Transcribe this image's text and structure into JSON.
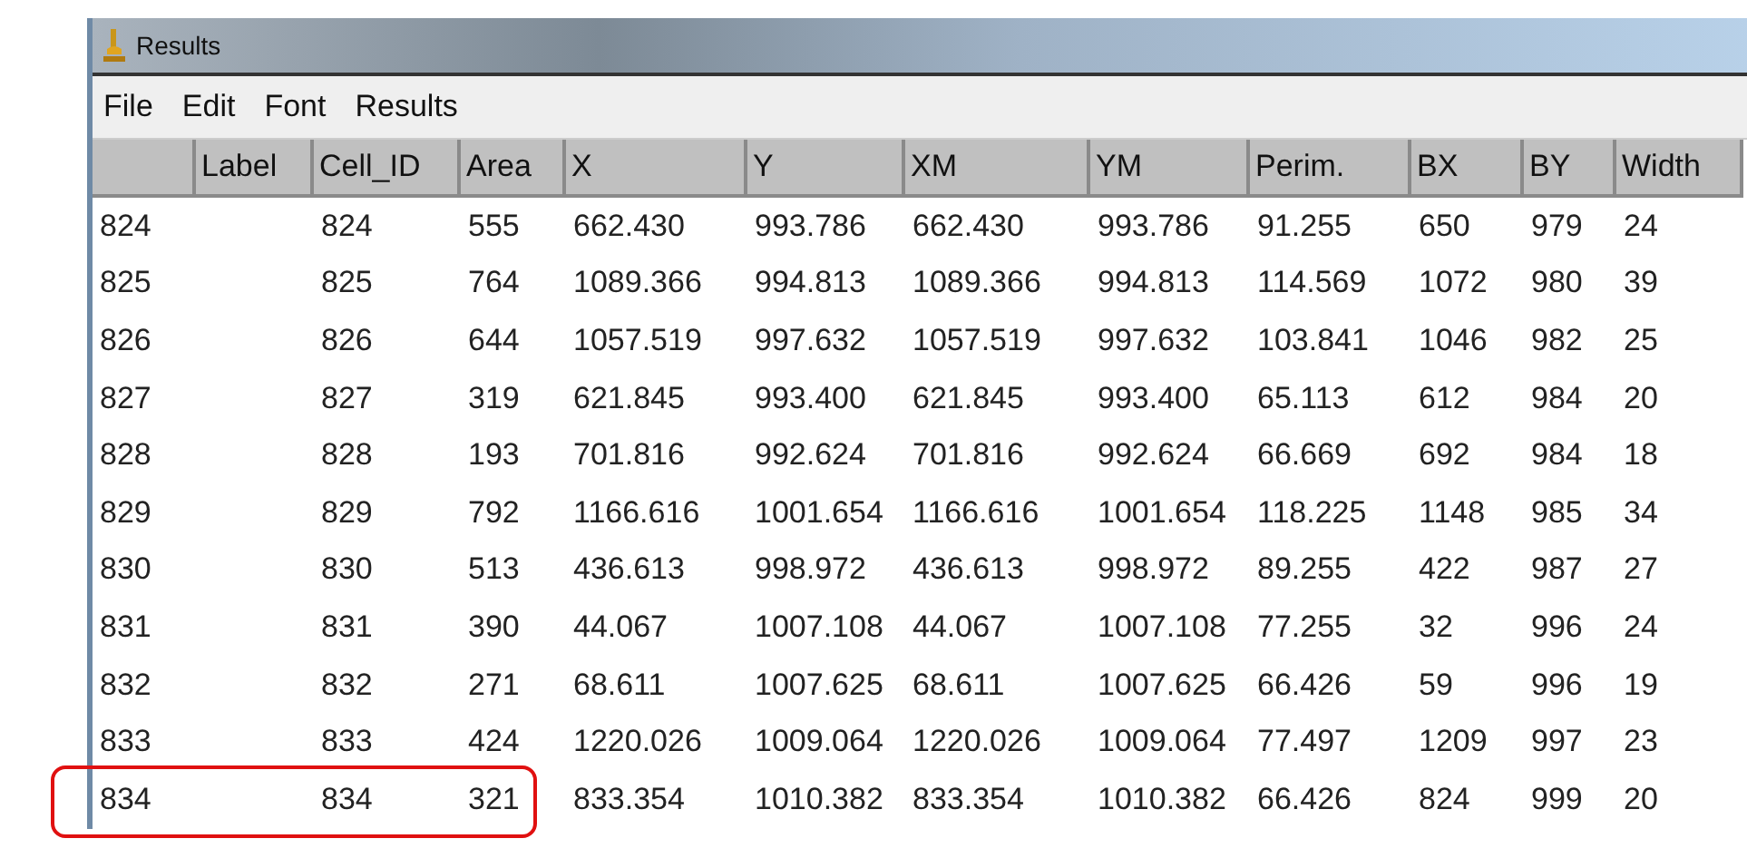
{
  "window": {
    "title": "Results"
  },
  "menu": [
    "File",
    "Edit",
    "Font",
    "Results"
  ],
  "table": {
    "columns": [
      "",
      "Label",
      "Cell_ID",
      "Area",
      "X",
      "Y",
      "XM",
      "YM",
      "Perim.",
      "BX",
      "BY",
      "Width"
    ],
    "rows": [
      {
        "cells": [
          "824",
          "",
          "824",
          "555",
          "662.430",
          "993.786",
          "662.430",
          "993.786",
          "91.255",
          "650",
          "979",
          "24"
        ],
        "highlighted": false
      },
      {
        "cells": [
          "825",
          "",
          "825",
          "764",
          "1089.366",
          "994.813",
          "1089.366",
          "994.813",
          "114.569",
          "1072",
          "980",
          "39"
        ],
        "highlighted": false
      },
      {
        "cells": [
          "826",
          "",
          "826",
          "644",
          "1057.519",
          "997.632",
          "1057.519",
          "997.632",
          "103.841",
          "1046",
          "982",
          "25"
        ],
        "highlighted": false
      },
      {
        "cells": [
          "827",
          "",
          "827",
          "319",
          "621.845",
          "993.400",
          "621.845",
          "993.400",
          "65.113",
          "612",
          "984",
          "20"
        ],
        "highlighted": false
      },
      {
        "cells": [
          "828",
          "",
          "828",
          "193",
          "701.816",
          "992.624",
          "701.816",
          "992.624",
          "66.669",
          "692",
          "984",
          "18"
        ],
        "highlighted": false
      },
      {
        "cells": [
          "829",
          "",
          "829",
          "792",
          "1166.616",
          "1001.654",
          "1166.616",
          "1001.654",
          "118.225",
          "1148",
          "985",
          "34"
        ],
        "highlighted": false
      },
      {
        "cells": [
          "830",
          "",
          "830",
          "513",
          "436.613",
          "998.972",
          "436.613",
          "998.972",
          "89.255",
          "422",
          "987",
          "27"
        ],
        "highlighted": false
      },
      {
        "cells": [
          "831",
          "",
          "831",
          "390",
          "44.067",
          "1007.108",
          "44.067",
          "1007.108",
          "77.255",
          "32",
          "996",
          "24"
        ],
        "highlighted": false
      },
      {
        "cells": [
          "832",
          "",
          "832",
          "271",
          "68.611",
          "1007.625",
          "68.611",
          "1007.625",
          "66.426",
          "59",
          "996",
          "19"
        ],
        "highlighted": false
      },
      {
        "cells": [
          "833",
          "",
          "833",
          "424",
          "1220.026",
          "1009.064",
          "1220.026",
          "1009.064",
          "77.497",
          "1209",
          "997",
          "23"
        ],
        "highlighted": false
      },
      {
        "cells": [
          "834",
          "",
          "834",
          "321",
          "833.354",
          "1010.382",
          "833.354",
          "1010.382",
          "66.426",
          "824",
          "999",
          "20"
        ],
        "highlighted": true
      }
    ]
  }
}
